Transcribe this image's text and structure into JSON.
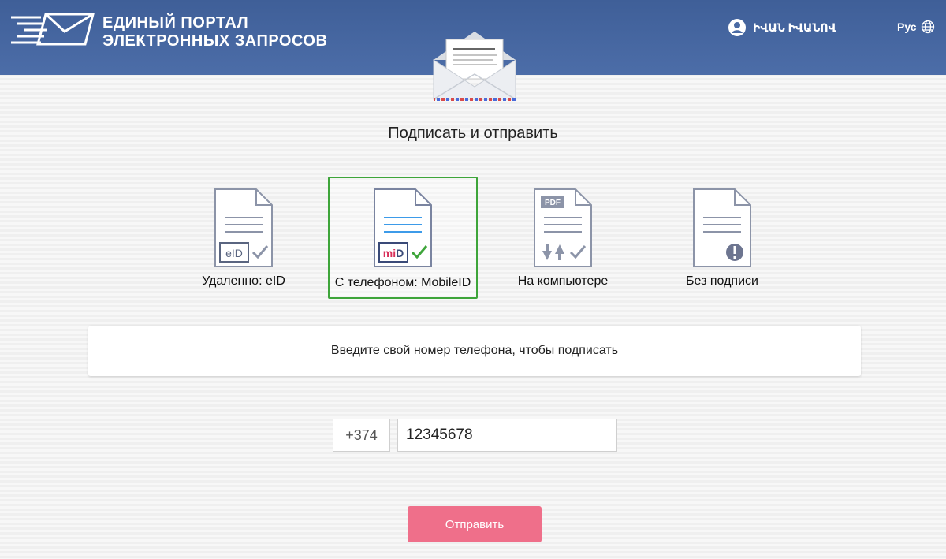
{
  "header": {
    "logo_line1": "ЕДИНЫЙ ПОРТАЛ",
    "logo_line2": "ЭЛЕКТРОННЫХ ЗАПРОСОВ",
    "user_name": "ԻՎԱՆ ԻՎԱՆՈՎ",
    "language": "Рус"
  },
  "page_title": "Подписать и отправить",
  "options": [
    {
      "label": "Удаленно: eID",
      "badge": "eID",
      "selected": false
    },
    {
      "label": "С телефоном: MobileID",
      "badge": "miD",
      "selected": true
    },
    {
      "label": "На компьютере",
      "badge": "PDF",
      "selected": false
    },
    {
      "label": "Без подписи",
      "badge": "!",
      "selected": false
    }
  ],
  "info_text": "Введите свой номер телефона, чтобы подписать",
  "phone": {
    "prefix": "+374",
    "value": "12345678"
  },
  "send_label": "Отправить",
  "colors": {
    "header": "#4a6aa4",
    "selected_border": "#3ea53a",
    "send_button": "#ef6f8a"
  }
}
